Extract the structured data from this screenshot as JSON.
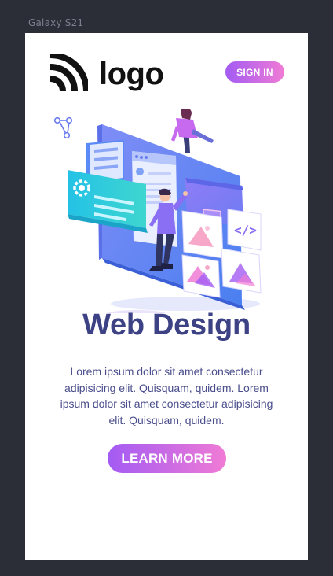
{
  "frame": {
    "device_label": "Galaxy S21"
  },
  "header": {
    "logo_text": "logo",
    "logo_icon": "wifi-arcs-icon",
    "signin_label": "SIGN IN"
  },
  "hero": {
    "illustration": "web-design-isometric-illustration",
    "share_icon": "share-nodes-icon",
    "title": "Web Design",
    "body": "Lorem ipsum dolor sit amet consectetur adipisicing elit. Quisquam, quidem. Lorem ipsum dolor sit amet consectetur adipisicing elit. Quisquam, quidem.",
    "cta_label": "LEARN MORE"
  },
  "colors": {
    "page_bg": "#2b2e36",
    "device_bg": "#ffffff",
    "title": "#3d4285",
    "body_text": "#4a4e8c",
    "button_gradient_start": "#a35bf3",
    "button_gradient_end": "#f07bd5"
  }
}
